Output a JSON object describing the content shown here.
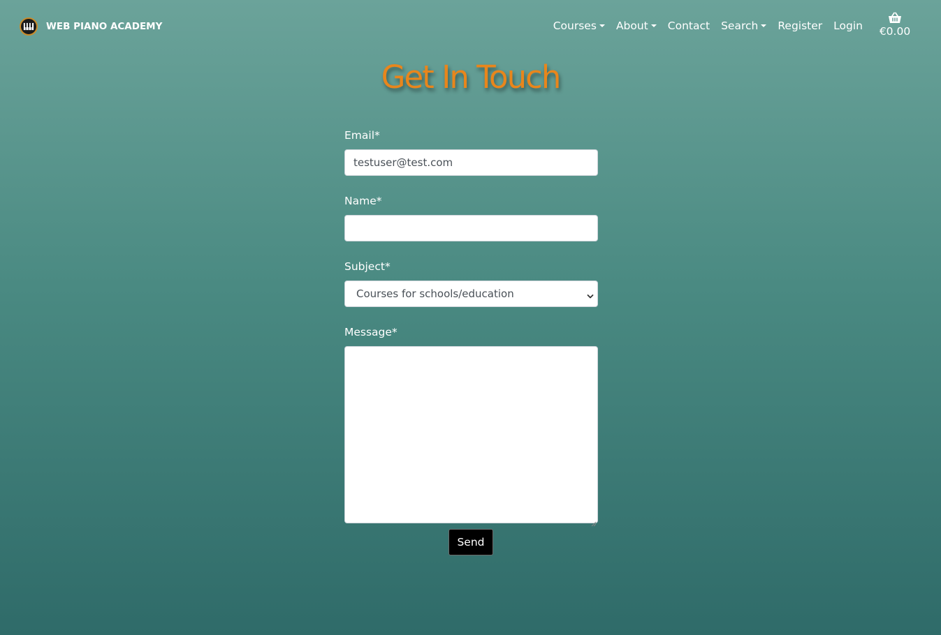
{
  "navbar": {
    "brand_name": "WEB PIANO ACADEMY",
    "logo_icon": "piano-keys-icon",
    "items": [
      {
        "label": "Courses",
        "dropdown": true
      },
      {
        "label": "About",
        "dropdown": true
      },
      {
        "label": "Contact",
        "dropdown": false
      },
      {
        "label": "Search",
        "dropdown": true
      },
      {
        "label": "Register",
        "dropdown": false
      },
      {
        "label": "Login",
        "dropdown": false
      }
    ],
    "cart": {
      "icon": "basket-icon",
      "total": "€0.00"
    }
  },
  "page": {
    "title": "Get In Touch"
  },
  "form": {
    "email_label": "Email*",
    "email_value": "testuser@test.com",
    "name_label": "Name*",
    "name_value": "",
    "subject_label": "Subject*",
    "subject_selected": "Courses for schools/education",
    "message_label": "Message*",
    "message_value": "",
    "send_label": "Send"
  },
  "colors": {
    "title": "#e8861c",
    "background_top": "#6ba39a",
    "background_bottom": "#2f6b69",
    "button": "#000000"
  }
}
